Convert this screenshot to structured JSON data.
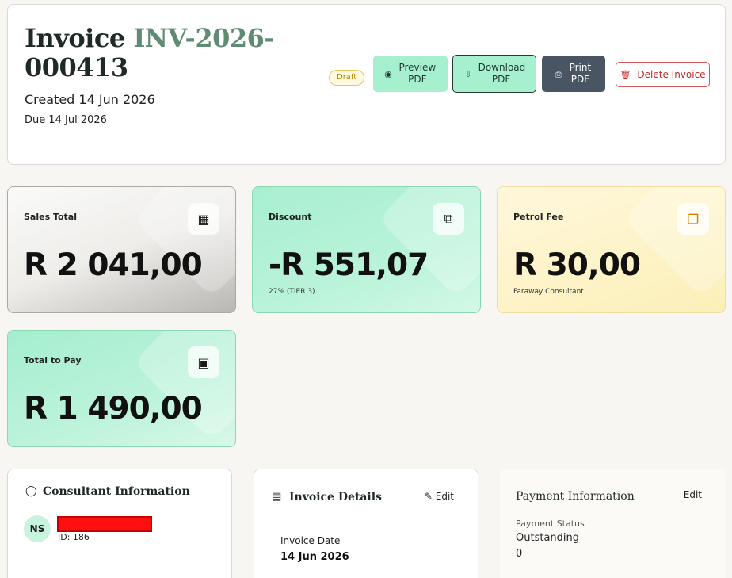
{
  "header": {
    "title_prefix": "Invoice",
    "invoice_number_part1": "INV-2026-",
    "invoice_number_part2": "000413",
    "created": "Created 14 Jun 2026",
    "due": "Due 14 Jul 2026",
    "status_badge": "Draft"
  },
  "actions": {
    "preview": "Preview PDF",
    "download": "Download PDF",
    "print": "Print PDF",
    "delete": "Delete Invoice"
  },
  "stats": {
    "sales": {
      "label": "Sales Total",
      "value": "R 2 041,00",
      "icon": "calculator-icon"
    },
    "discount": {
      "label": "Discount",
      "value": "-R 551,07",
      "sub": "27% (TIER 3)",
      "icon": "tag-icon"
    },
    "petrol": {
      "label": "Petrol Fee",
      "value": "R 30,00",
      "sub": "Faraway Consultant",
      "icon": "copy-icon"
    },
    "total": {
      "label": "Total to Pay",
      "value": "R 1 490,00",
      "icon": "cash-icon"
    }
  },
  "consultant": {
    "title": "Consultant Information",
    "initials": "NS",
    "id": "ID: 186"
  },
  "details": {
    "title": "Invoice Details",
    "edit": "Edit",
    "invoice_date_label": "Invoice Date",
    "invoice_date": "14 Jun 2026"
  },
  "payment": {
    "title": "Payment Information",
    "edit": "Edit",
    "status_label": "Payment Status",
    "status": "Outstanding",
    "amount": "0"
  },
  "colors": {
    "accent_green": "#a7f0cf",
    "invoice_number_green": "#5e8b72",
    "delete_red": "#c02a2a",
    "print_dark": "#4a5563"
  }
}
